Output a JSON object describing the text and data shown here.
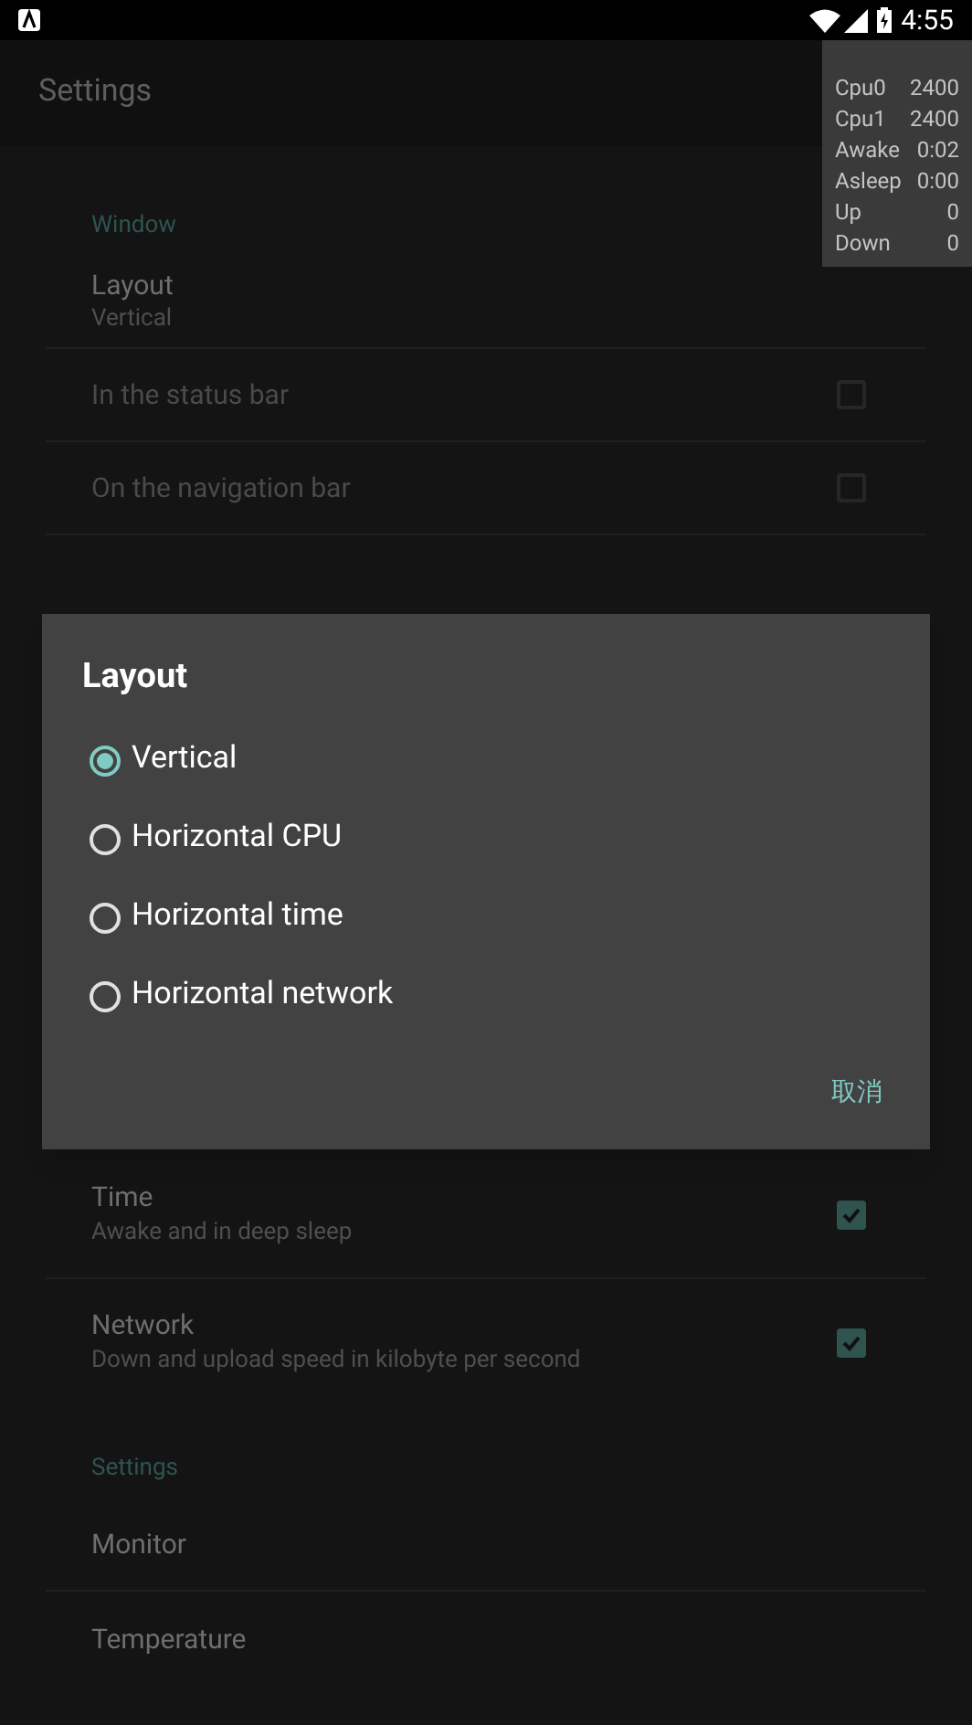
{
  "status_bar": {
    "time": "4:55"
  },
  "app_bar": {
    "title": "Settings"
  },
  "monitor_overlay": [
    {
      "label": "Cpu0",
      "value": "2400"
    },
    {
      "label": "Cpu1",
      "value": "2400"
    },
    {
      "label": "Awake",
      "value": "0:02"
    },
    {
      "label": "Asleep",
      "value": "0:00"
    },
    {
      "label": "Up",
      "value": "0"
    },
    {
      "label": "Down",
      "value": "0"
    }
  ],
  "sections_top": [
    {
      "kind": "header",
      "title": "Window"
    },
    {
      "kind": "item",
      "title": "Layout",
      "summary": "Vertical"
    },
    {
      "kind": "check",
      "title": "In the status bar",
      "checked": false,
      "disabled": true
    },
    {
      "kind": "check",
      "title": "On the navigation bar",
      "checked": false,
      "disabled": true
    }
  ],
  "sections_bottom": [
    {
      "kind": "check",
      "title": "Time",
      "summary": "Awake and in deep sleep",
      "checked": true,
      "disabled": false
    },
    {
      "kind": "check",
      "title": "Network",
      "summary": "Down and upload speed in kilobyte per second",
      "checked": true,
      "disabled": false
    },
    {
      "kind": "header",
      "title": "Settings"
    },
    {
      "kind": "item",
      "title": "Monitor"
    },
    {
      "kind": "item",
      "title": "Temperature"
    }
  ],
  "dialog": {
    "title": "Layout",
    "options": [
      {
        "label": "Vertical",
        "selected": true
      },
      {
        "label": "Horizontal CPU",
        "selected": false
      },
      {
        "label": "Horizontal time",
        "selected": false
      },
      {
        "label": "Horizontal network",
        "selected": false
      }
    ],
    "button": "取消"
  }
}
